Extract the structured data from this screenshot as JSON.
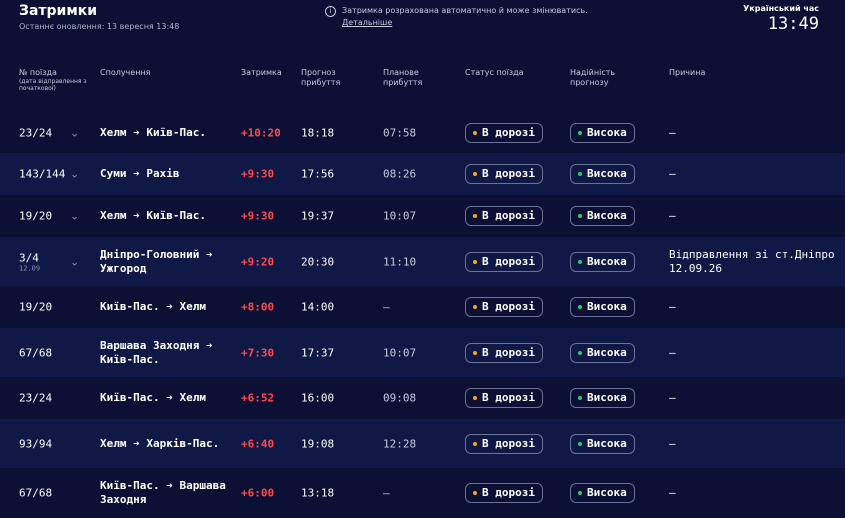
{
  "header": {
    "title": "Затримки",
    "updated": "Останнє оновлення: 13 вересня 13:48",
    "notice": "Затримка розрахована автоматично й може змінюватись.",
    "notice_link": "Детальніше",
    "clock_label": "Український час",
    "clock_time": "13:49"
  },
  "columns": {
    "train": "№ поїзда",
    "train_note": "(дата відправлення з початкової)",
    "route": "Сполучення",
    "delay": "Затримка",
    "forecast": "Прогноз прибуття",
    "planned": "Планове прибуття",
    "status": "Статус поїзда",
    "reliability": "Надійність прогнозу",
    "reason": "Причина"
  },
  "colors": {
    "status_dot": "#f5a623",
    "reliability_dot": "#2ecc71",
    "delay": "#ff4b4b"
  },
  "rows": [
    {
      "train": "23/24",
      "date": "",
      "expand": "⌄",
      "route": "Хелм ➔  Київ-Пас.",
      "delay": "+10:20",
      "forecast": "18:18",
      "planned": "07:58",
      "status": "В дорозі",
      "reliability": "Висока",
      "reason": "—"
    },
    {
      "train": "143/144",
      "date": "",
      "expand": "⌄",
      "route": "Суми ➔  Рахів",
      "delay": "+9:30",
      "forecast": "17:56",
      "planned": "08:26",
      "status": "В дорозі",
      "reliability": "Висока",
      "reason": "—"
    },
    {
      "train": "19/20",
      "date": "",
      "expand": "⌄",
      "route": "Хелм ➔  Київ-Пас.",
      "delay": "+9:30",
      "forecast": "19:37",
      "planned": "10:07",
      "status": "В дорозі",
      "reliability": "Висока",
      "reason": "—"
    },
    {
      "train": "3/4",
      "date": "12.09",
      "expand": "⌄",
      "route": "Дніпро-Головний ➔ Ужгород",
      "delay": "+9:20",
      "forecast": "20:30",
      "planned": "11:10",
      "status": "В дорозі",
      "reliability": "Висока",
      "reason": "Відправлення зі ст.Дніпро 12.09.26"
    },
    {
      "train": "19/20",
      "date": "",
      "expand": "",
      "route": "Київ-Пас. ➔  Хелм",
      "delay": "+8:00",
      "forecast": "14:00",
      "planned": "—",
      "status": "В дорозі",
      "reliability": "Висока",
      "reason": "—"
    },
    {
      "train": "67/68",
      "date": "",
      "expand": "",
      "route": "Варшава Заходня ➔ Київ-Пас.",
      "delay": "+7:30",
      "forecast": "17:37",
      "planned": "10:07",
      "status": "В дорозі",
      "reliability": "Висока",
      "reason": "—"
    },
    {
      "train": "23/24",
      "date": "",
      "expand": "",
      "route": "Київ-Пас. ➔  Хелм",
      "delay": "+6:52",
      "forecast": "16:00",
      "planned": "09:08",
      "status": "В дорозі",
      "reliability": "Висока",
      "reason": "—"
    },
    {
      "train": "93/94",
      "date": "",
      "expand": "",
      "route": "Хелм ➔  Харків-Пас.",
      "delay": "+6:40",
      "forecast": "19:08",
      "planned": "12:28",
      "status": "В дорозі",
      "reliability": "Висока",
      "reason": "—"
    },
    {
      "train": "67/68",
      "date": "",
      "expand": "",
      "route": "Київ-Пас. ➔ Варшава Заходня",
      "delay": "+6:00",
      "forecast": "13:18",
      "planned": "—",
      "status": "В дорозі",
      "reliability": "Висока",
      "reason": "—"
    }
  ]
}
